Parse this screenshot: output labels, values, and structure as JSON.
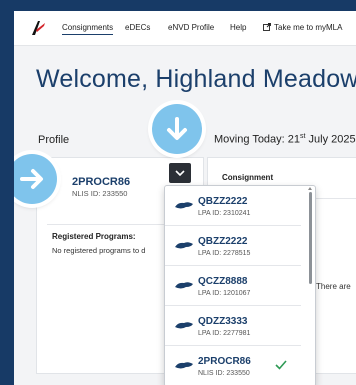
{
  "nav": {
    "items": [
      "Consignments",
      "eDECs",
      "eNVD Profile",
      "Help",
      "Take me to myMLA"
    ]
  },
  "welcome": "Welcome, Highland Meadows",
  "profile_label": "Profile",
  "moving": {
    "prefix": "Moving Today: 21",
    "suffix": "st",
    "rest": " July 2025"
  },
  "current_profile": {
    "name": "2PROCR86",
    "nlis": "NLIS ID: 233550"
  },
  "registered": {
    "title": "Registered Programs:",
    "text": "No registered programs to d"
  },
  "consignment": {
    "title": "Consignment",
    "empty_text": "There are"
  },
  "dropdown_items": [
    {
      "name": "QBZZ2222",
      "id": "LPA ID: 2310241",
      "selected": false
    },
    {
      "name": "QBZZ2222",
      "id": "LPA ID: 2278515",
      "selected": false
    },
    {
      "name": "QCZZ8888",
      "id": "LPA ID: 1201067",
      "selected": false
    },
    {
      "name": "QDZZ3333",
      "id": "LPA ID: 2277981",
      "selected": false
    },
    {
      "name": "2PROCR86",
      "id": "NLIS ID: 233550",
      "selected": true
    }
  ],
  "colors": {
    "brand": "#1b3f6b",
    "accent_circle": "#7fc4ec",
    "check": "#2e9a55",
    "background": "#173a66"
  },
  "icons": [
    "logo-icon",
    "external-link-icon",
    "arrow-right-icon",
    "arrow-down-icon",
    "chevron-down-icon",
    "shoe-icon",
    "check-icon"
  ]
}
